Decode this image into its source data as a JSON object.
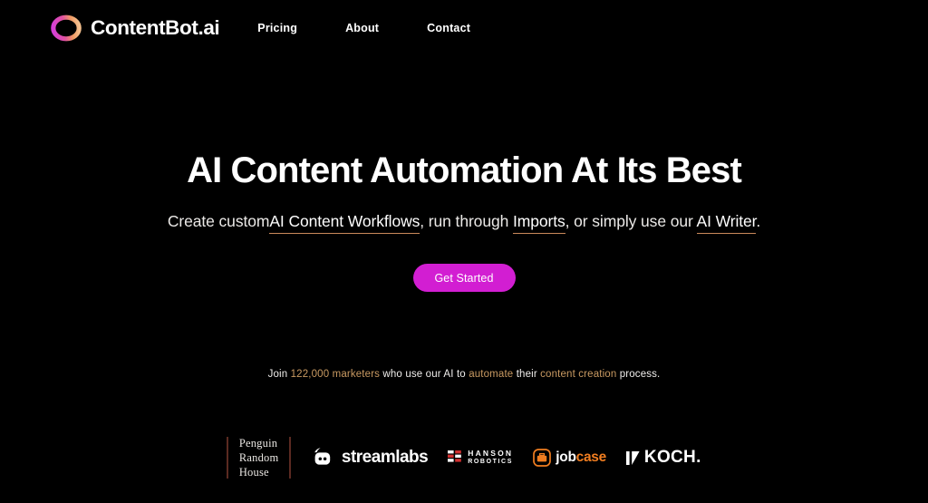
{
  "page": {
    "background_color": "#000000",
    "accent_magenta": "#d21ed2",
    "accent_tan": "#c9895a",
    "accent_gold": "#c99a62"
  },
  "header": {
    "logo_icon": "contentbot-ring-icon",
    "brand_name": "ContentBot.ai",
    "nav": [
      {
        "label": "Pricing",
        "name": "nav-item-pricing"
      },
      {
        "label": "About",
        "name": "nav-item-about"
      },
      {
        "label": "Contact",
        "name": "nav-item-contact"
      }
    ]
  },
  "hero": {
    "headline": "AI Content Automation At Its Best",
    "subhead": {
      "part1": "Create custom",
      "link1": "AI Content Workflows",
      "part2": ", run through",
      "link2": "Imports",
      "part3": ", or simply use our",
      "link3": "AI Writer",
      "part4": "."
    },
    "cta_label": "Get Started"
  },
  "social_proof": {
    "prefix": "Join ",
    "count_highlight": "122,000 marketers",
    "mid1": " who use our AI to ",
    "highlight2": "automate",
    "mid2": " their ",
    "highlight3": "content creation",
    "suffix": " process."
  },
  "logo_strip": {
    "logos": [
      {
        "name": "penguin-random-house-logo",
        "line1": "Penguin",
        "line2": "Random",
        "line3": "House"
      },
      {
        "name": "streamlabs-logo",
        "text": "streamlabs",
        "icon": "streamlabs-icon"
      },
      {
        "name": "hanson-robotics-logo",
        "line1": "HANSON",
        "line2": "ROBOTICS",
        "icon": "hanson-grid-icon"
      },
      {
        "name": "jobcase-logo",
        "text_white": "job",
        "text_orange": "case",
        "icon": "jobcase-briefcase-icon"
      },
      {
        "name": "koch-logo",
        "text": "KOCH.",
        "icon": "koch-mark-icon"
      }
    ]
  }
}
